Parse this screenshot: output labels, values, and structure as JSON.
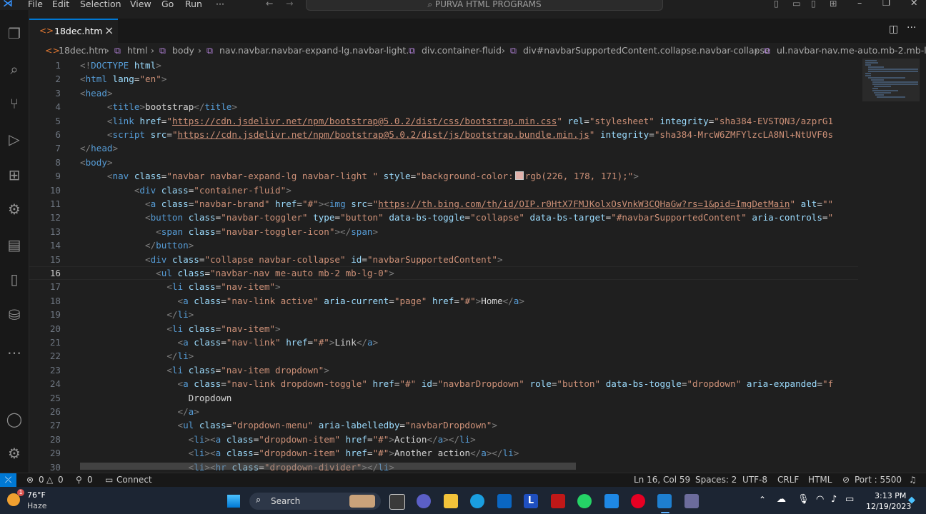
{
  "menu": [
    "File",
    "Edit",
    "Selection",
    "View",
    "Go",
    "Run",
    "···"
  ],
  "command_center": "PURVA HTML PROGRAMS",
  "tab": {
    "label": "18dec.htm",
    "close": "×"
  },
  "breadcrumb": [
    "18dec.htm",
    "html",
    "body",
    "nav.navbar.navbar-expand-lg.navbar-light.",
    "div.container-fluid",
    "div#navbarSupportedContent.collapse.navbar-collapse",
    "ul.navbar-nav.me-auto.mb-2.mb-lg-"
  ],
  "line_numbers": [
    "1",
    "2",
    "3",
    "4",
    "5",
    "6",
    "7",
    "8",
    "9",
    "10",
    "11",
    "12",
    "13",
    "14",
    "15",
    "16",
    "17",
    "18",
    "19",
    "20",
    "21",
    "22",
    "23",
    "24",
    "25",
    "26",
    "27",
    "28",
    "29",
    "30"
  ],
  "current_line": "16",
  "status": {
    "errors": "0",
    "warnings": "0",
    "ports_count": "0",
    "connect": "Connect",
    "position": "Ln 16, Col 59",
    "spaces": "Spaces: 2",
    "encoding": "UTF-8",
    "eol": "CRLF",
    "language": "HTML",
    "port": "Port : 5500"
  },
  "taskbar": {
    "temp": "76°F",
    "weather": "Haze",
    "search": "Search",
    "time": "3:13 PM",
    "date": "12/19/2023",
    "weather_badge": "1"
  },
  "colors": {
    "accent": "#0078d4",
    "swatch": "#e2b2ab",
    "statusbar_bg": "#181818"
  }
}
